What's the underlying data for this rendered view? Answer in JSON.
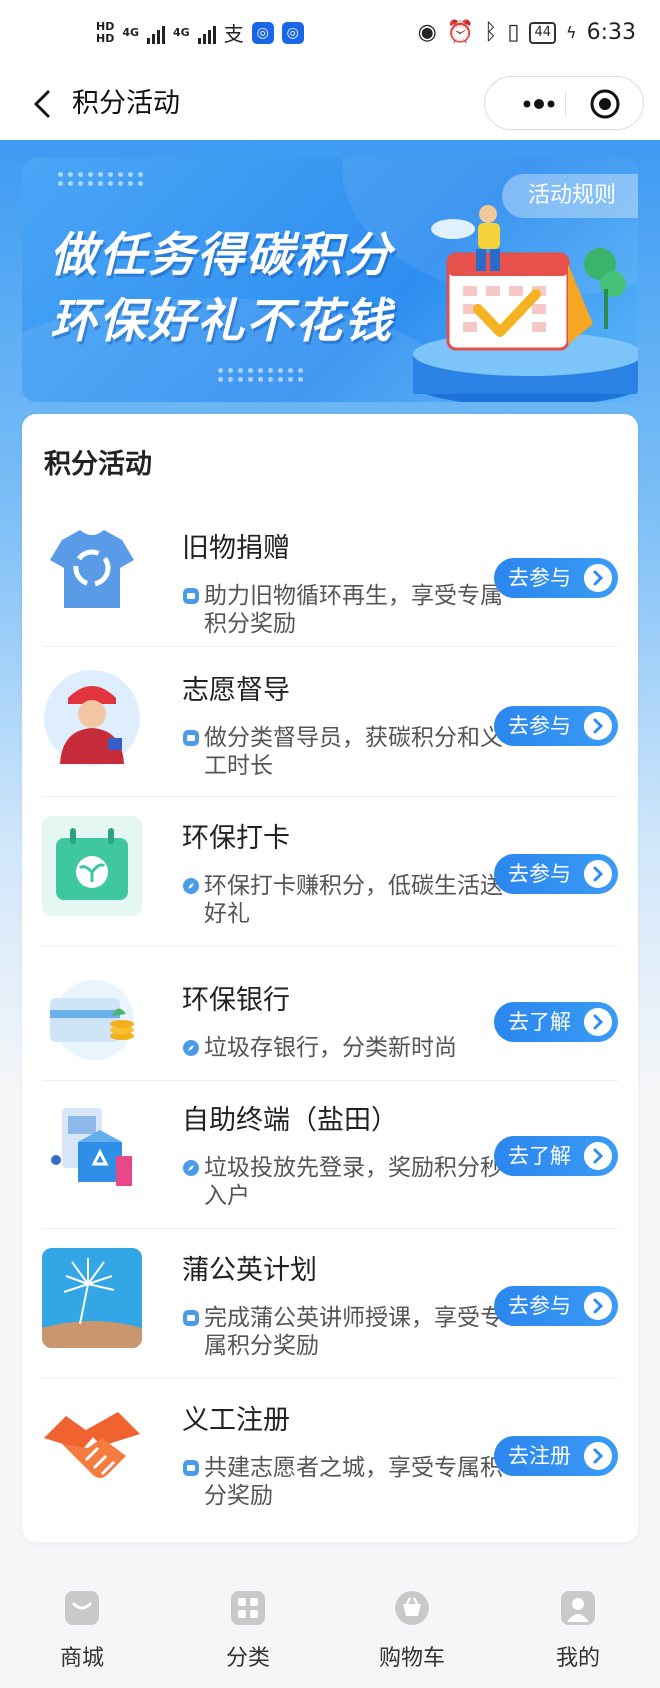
{
  "status_bar": {
    "network_labels": [
      "HD",
      "HD",
      "4G",
      "4G"
    ],
    "battery": "44",
    "time": "6:33"
  },
  "header": {
    "title": "积分活动"
  },
  "banner": {
    "line1": "做任务得碳积分",
    "line2": "环保好礼不花钱",
    "rules_label": "活动规则"
  },
  "section": {
    "title": "积分活动"
  },
  "activities": [
    {
      "name": "旧物捐赠",
      "desc": "助力旧物循环再生，享受专属积分奖励",
      "button": "去参与",
      "icon": "tshirt-recycle-icon"
    },
    {
      "name": "志愿督导",
      "desc": "做分类督导员，获碳积分和义工时长",
      "button": "去参与",
      "icon": "volunteer-icon"
    },
    {
      "name": "环保打卡",
      "desc": "环保打卡赚积分，低碳生活送好礼",
      "button": "去参与",
      "icon": "calendar-sprout-icon"
    },
    {
      "name": "环保银行",
      "desc": "垃圾存银行，分类新时尚",
      "button": "去了解",
      "icon": "bank-card-icon"
    },
    {
      "name": "自助终端（盐田）",
      "desc": "垃圾投放先登录，奖励积分秒入户",
      "button": "去了解",
      "icon": "terminal-icon"
    },
    {
      "name": "蒲公英计划",
      "desc": "完成蒲公英讲师授课，享受专属积分奖励",
      "button": "去参与",
      "icon": "dandelion-icon"
    },
    {
      "name": "义工注册",
      "desc": "共建志愿者之城，享受专属积分奖励",
      "button": "去注册",
      "icon": "handshake-icon"
    }
  ],
  "tabbar": {
    "items": [
      {
        "label": "商城",
        "icon": "shop-icon"
      },
      {
        "label": "分类",
        "icon": "category-icon"
      },
      {
        "label": "购物车",
        "icon": "cart-icon"
      },
      {
        "label": "我的",
        "icon": "user-icon"
      }
    ]
  },
  "colors": {
    "primary": "#2e8ef0",
    "banner_bg": "#3d9bf2",
    "text": "#222222",
    "subtext": "#555555"
  }
}
